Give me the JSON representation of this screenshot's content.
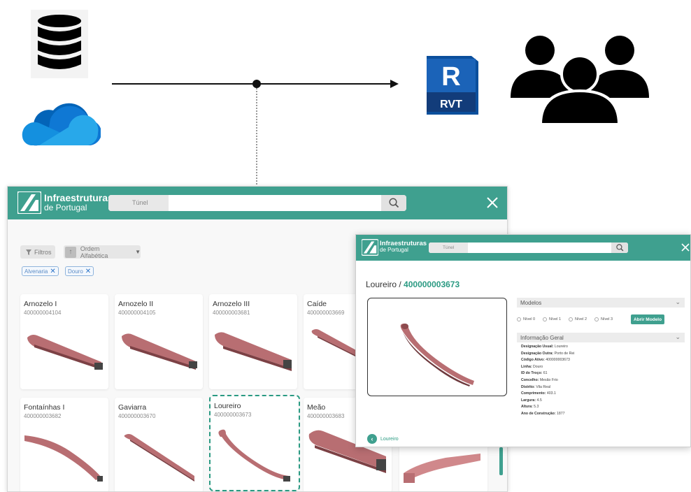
{
  "sources": [
    "database-icon",
    "onedrive-cloud-icon"
  ],
  "targets": {
    "rvt_letter": "R",
    "rvt_label": "RVT",
    "users_icon": "users-group-icon"
  },
  "main_window": {
    "logo_line1": "Infraestruturas",
    "logo_line2": "de Portugal",
    "search_value": "Túnel",
    "filters_label": "Filtros",
    "sort_label": "Ordem Alfabética",
    "chips": [
      "Alvenaria",
      "Douro"
    ],
    "cards": [
      {
        "name": "Arnozelo I",
        "code": "400000004104"
      },
      {
        "name": "Arnozelo II",
        "code": "400000004105"
      },
      {
        "name": "Arnozelo III",
        "code": "400000003681"
      },
      {
        "name": "Caíde",
        "code": "400000003669"
      },
      {
        "name": "Fontaínhas I",
        "code": "400000003682"
      },
      {
        "name": "Gaviarra",
        "code": "400000003670"
      },
      {
        "name": "Loureiro",
        "code": "400000003673"
      },
      {
        "name": "Meão",
        "code": "400000003683"
      }
    ]
  },
  "detail_window": {
    "logo_line1": "Infraestruturas",
    "logo_line2": "de Portugal",
    "search_value": "Túnel",
    "title_name": "Loureiro /",
    "title_code": "400000003673",
    "models_header": "Modelos",
    "levels": [
      "Nível 0",
      "Nível 1",
      "Nível 2",
      "Nível 3"
    ],
    "open_button": "Abrir Modelo",
    "info_header": "Informação Geral",
    "info": [
      {
        "k": "Designação Usual:",
        "v": "Loureiro"
      },
      {
        "k": "Designação Outra:",
        "v": "Porto de Rei"
      },
      {
        "k": "Código Ativo:",
        "v": "400000003673"
      },
      {
        "k": "Linha:",
        "v": "Douro"
      },
      {
        "k": "ID do Troço:",
        "v": "61"
      },
      {
        "k": "Concelho:",
        "v": "Mesão Frio"
      },
      {
        "k": "Distrito:",
        "v": "Vila Real"
      },
      {
        "k": "Comprimento:",
        "v": "403.1"
      },
      {
        "k": "Largura:",
        "v": "4.5"
      },
      {
        "k": "Altura:",
        "v": "5.3"
      },
      {
        "k": "Ano de Construção:",
        "v": "1877"
      }
    ],
    "back_label": "Loureiro"
  },
  "colors": {
    "brand": "#3fa08f",
    "accent_text": "#2a9a82",
    "tunnel": "#b86e72",
    "rvt_blue": "#1b63b8"
  }
}
